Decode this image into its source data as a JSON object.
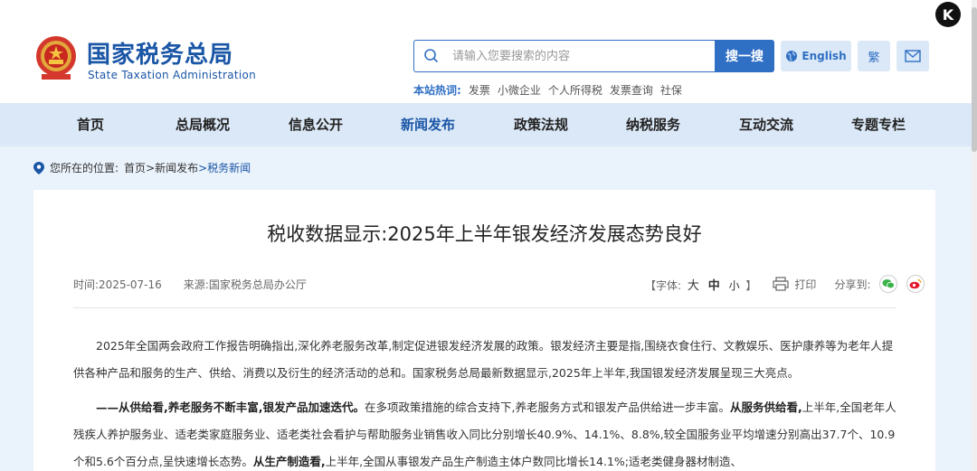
{
  "header": {
    "site_name_cn": "国家税务总局",
    "site_name_en": "State Taxation Administration",
    "search": {
      "placeholder": "请输入您要搜索的内容",
      "button_label": "搜一搜"
    },
    "english_label": "English",
    "traditional_label": "繁",
    "hotwords_label": "本站热词:",
    "hotwords": [
      "发票",
      "小微企业",
      "个人所得税",
      "发票查询",
      "社保"
    ],
    "badge_letter": "K"
  },
  "nav": {
    "items": [
      "首页",
      "总局概况",
      "信息公开",
      "新闻发布",
      "政策法规",
      "纳税服务",
      "互动交流",
      "专题专栏"
    ],
    "active": "新闻发布"
  },
  "breadcrumb": {
    "prefix": "您所在的位置:",
    "home": "首页",
    "level1": ">新闻发布",
    "level2": ">税务新闻"
  },
  "article": {
    "title": "税收数据显示:2025年上半年银发经济发展态势良好",
    "time": "时间:2025-07-16",
    "source": "来源:国家税务总局办公厅",
    "font_label_open": "【字体:",
    "font_large": "大",
    "font_medium": "中",
    "font_small": "小",
    "font_label_close": "】",
    "print_label": "打印",
    "share_label": "分享到:",
    "p1": "2025年全国两会政府工作报告明确指出,深化养老服务改革,制定促进银发经济发展的政策。银发经济主要是指,围绕衣食住行、文教娱乐、医护康养等为老年人提供各种产品和服务的生产、供给、消费以及衍生的经济活动的总和。国家税务总局最新数据显示,2025年上半年,我国银发经济发展呈现三大亮点。",
    "p2_bold1": "——从供给看,养老服务不断丰富,银发产品加速迭代。",
    "p2_text1": "在多项政策措施的综合支持下,养老服务方式和银发产品供给进一步丰富。",
    "p2_bold2": "从服务供给看,",
    "p2_text2": "上半年,全国老年人残疾人养护服务业、适老类家庭服务业、适老类社会看护与帮助服务业销售收入同比分别增长40.9%、14.1%、8.8%,较全国服务业平均增速分别高出37.7个、10.9个和5.6个百分点,呈快速增长态势。",
    "p2_bold3": "从生产制造看,",
    "p2_text3": "上半年,全国从事银发产品生产制造主体户数同比增长14.1%;适老类健身器材制造、"
  }
}
